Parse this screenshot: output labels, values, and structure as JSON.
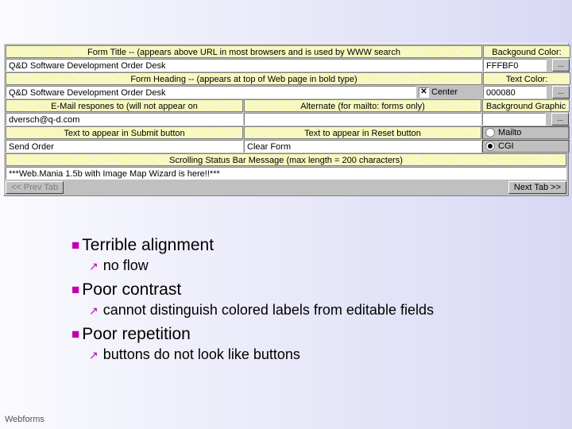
{
  "form": {
    "row1": {
      "titleLabel": "Form Title -- (appears above URL in most browsers and is used by WWW search",
      "bgLabel": "Backgound Color:"
    },
    "row2": {
      "titleValue": "Q&D Software Development Order Desk",
      "bgValue": "FFFBF0",
      "dots": "..."
    },
    "row3": {
      "headingLabel": "Form Heading -- (appears at top of Web page in bold type)",
      "txtLabel": "Text Color:"
    },
    "row4": {
      "headingValue": "Q&D Software Development Order Desk",
      "centerLabel": "Center",
      "txtValue": "000080",
      "dots": "..."
    },
    "row5": {
      "emailLabel": "E-Mail respones to (will not appear on",
      "altLabel": "Alternate (for mailto: forms only)",
      "bgGraphicLabel": "Background Graphic"
    },
    "row6": {
      "emailValue": "dversch@q-d.com",
      "altValue": "",
      "bgGraphicValue": "",
      "dots": "..."
    },
    "row7": {
      "submitLabel": "Text to appear in Submit button",
      "resetLabel": "Text to appear in Reset button",
      "mailtoLabel": "Mailto",
      "cgiLabel": "CGI"
    },
    "row8": {
      "submitValue": "Send Order",
      "resetValue": "Clear Form"
    },
    "row9": {
      "statusLabel": "Scrolling Status Bar Message (max length = 200 characters)"
    },
    "row10": {
      "statusValue": "***Web.Mania 1.5b with Image Map Wizard is here!!***"
    },
    "prevTab": "<< Prev Tab",
    "nextTab": "Next Tab >>"
  },
  "bullets": {
    "b1": "Terrible alignment",
    "b1a": "no flow",
    "b2": "Poor contrast",
    "b2a": "cannot distinguish colored labels from editable fields",
    "b3": "Poor repetition",
    "b3a": "buttons do not look like buttons"
  },
  "footer": "Webforms"
}
